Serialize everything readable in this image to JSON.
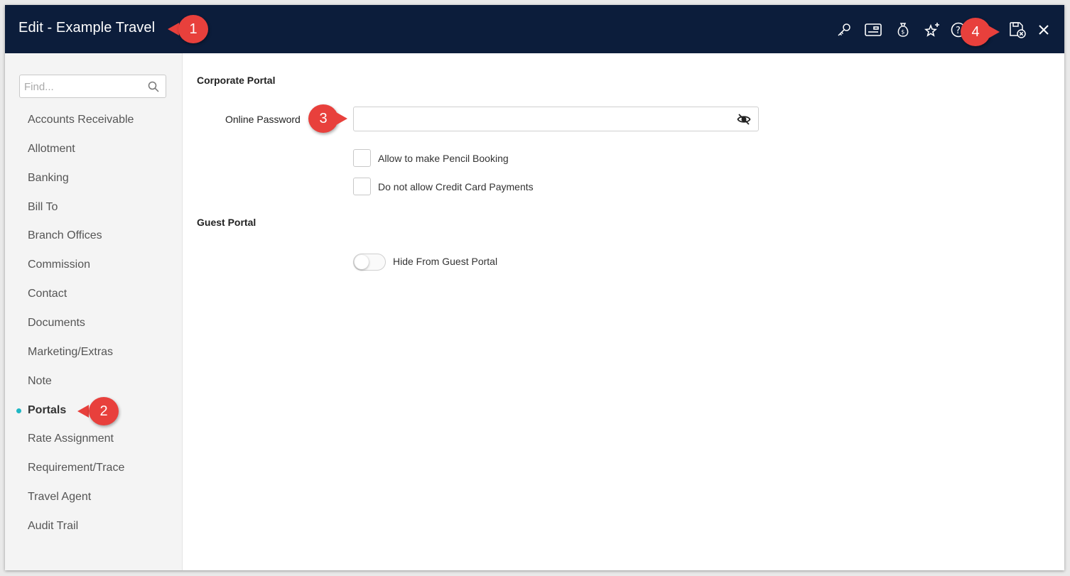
{
  "window": {
    "title": "Edit - Example Travel",
    "toolbar_icons": [
      "key-icon",
      "card-icon",
      "money-bag-icon",
      "sparkle-star-icon",
      "help-icon",
      "save-close-icon",
      "close-icon"
    ]
  },
  "sidebar": {
    "search": {
      "placeholder": "Find...",
      "value": ""
    },
    "items": [
      {
        "label": "Accounts Receivable"
      },
      {
        "label": "Allotment"
      },
      {
        "label": "Banking"
      },
      {
        "label": "Bill To"
      },
      {
        "label": "Branch Offices"
      },
      {
        "label": "Commission"
      },
      {
        "label": "Contact"
      },
      {
        "label": "Documents"
      },
      {
        "label": "Marketing/Extras"
      },
      {
        "label": "Note"
      },
      {
        "label": "Portals",
        "active": true
      },
      {
        "label": "Rate Assignment"
      },
      {
        "label": "Requirement/Trace"
      },
      {
        "label": "Travel Agent"
      },
      {
        "label": "Audit Trail"
      }
    ]
  },
  "main": {
    "corporate_portal": {
      "title": "Corporate Portal",
      "password_label": "Online Password",
      "password_value": "",
      "checkboxes": [
        {
          "label": "Allow to make Pencil Booking",
          "checked": false
        },
        {
          "label": "Do not allow Credit Card Payments",
          "checked": false
        }
      ]
    },
    "guest_portal": {
      "title": "Guest Portal",
      "toggle_label": "Hide From Guest Portal",
      "toggle_on": false
    }
  },
  "callouts": [
    "1",
    "2",
    "3",
    "4"
  ],
  "colors": {
    "titlebar": "#0c1d3b",
    "accent_dot": "#1fb7c4",
    "callout": "#e8403c"
  }
}
